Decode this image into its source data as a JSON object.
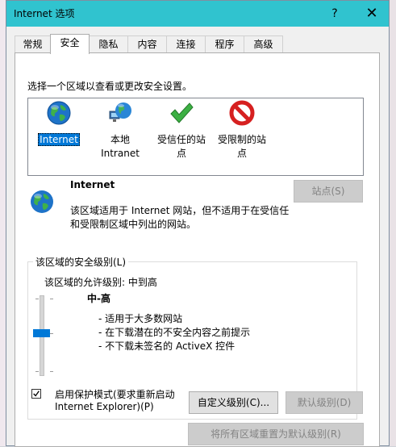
{
  "window": {
    "title": "Internet 选项",
    "help_glyph": "?",
    "close_glyph": "✕"
  },
  "tabs": [
    {
      "label": "常规"
    },
    {
      "label": "安全"
    },
    {
      "label": "隐私"
    },
    {
      "label": "内容"
    },
    {
      "label": "连接"
    },
    {
      "label": "程序"
    },
    {
      "label": "高级"
    }
  ],
  "active_tab": "安全",
  "zones": {
    "prompt": "选择一个区域以查看或更改安全设置。",
    "items": [
      {
        "line1": "Internet",
        "line2": "",
        "icon": "globe-icon",
        "selected": true
      },
      {
        "line1": "本地",
        "line2": "Intranet",
        "icon": "local-intranet-icon",
        "selected": false
      },
      {
        "line1": "受信任的站",
        "line2": "点",
        "icon": "checkmark-icon",
        "selected": false
      },
      {
        "line1": "受限制的站",
        "line2": "点",
        "icon": "restricted-icon",
        "selected": false
      }
    ]
  },
  "zone_detail": {
    "name": "Internet",
    "desc_line1": "该区域适用于 Internet 网站，但不适用于在受信任",
    "desc_line2": "和受限制区域中列出的网站。",
    "sites_button": "站点(S)"
  },
  "security_level": {
    "group_title": "该区域的安全级别(L)",
    "allowed_label": "该区域的允许级别: 中到高",
    "level_name": "中-高",
    "bullets": [
      "- 适用于大多数网站",
      "- 在下载潜在的不安全内容之前提示",
      "- 不下载未签名的 ActiveX 控件"
    ],
    "slider_position": "2 of 3 (中-高)"
  },
  "protected_mode": {
    "checked": true,
    "line1": "启用保护模式(要求重新启动",
    "line2": "Internet Explorer)(P)"
  },
  "buttons": {
    "custom_level": "自定义级别(C)...",
    "default_level": "默认级别(D)",
    "reset_all": "将所有区域重置为默认级别(R)"
  },
  "colors": {
    "titlebar": "#30c3cf",
    "selection": "#0078d7",
    "slider_thumb": "#0078d7"
  }
}
